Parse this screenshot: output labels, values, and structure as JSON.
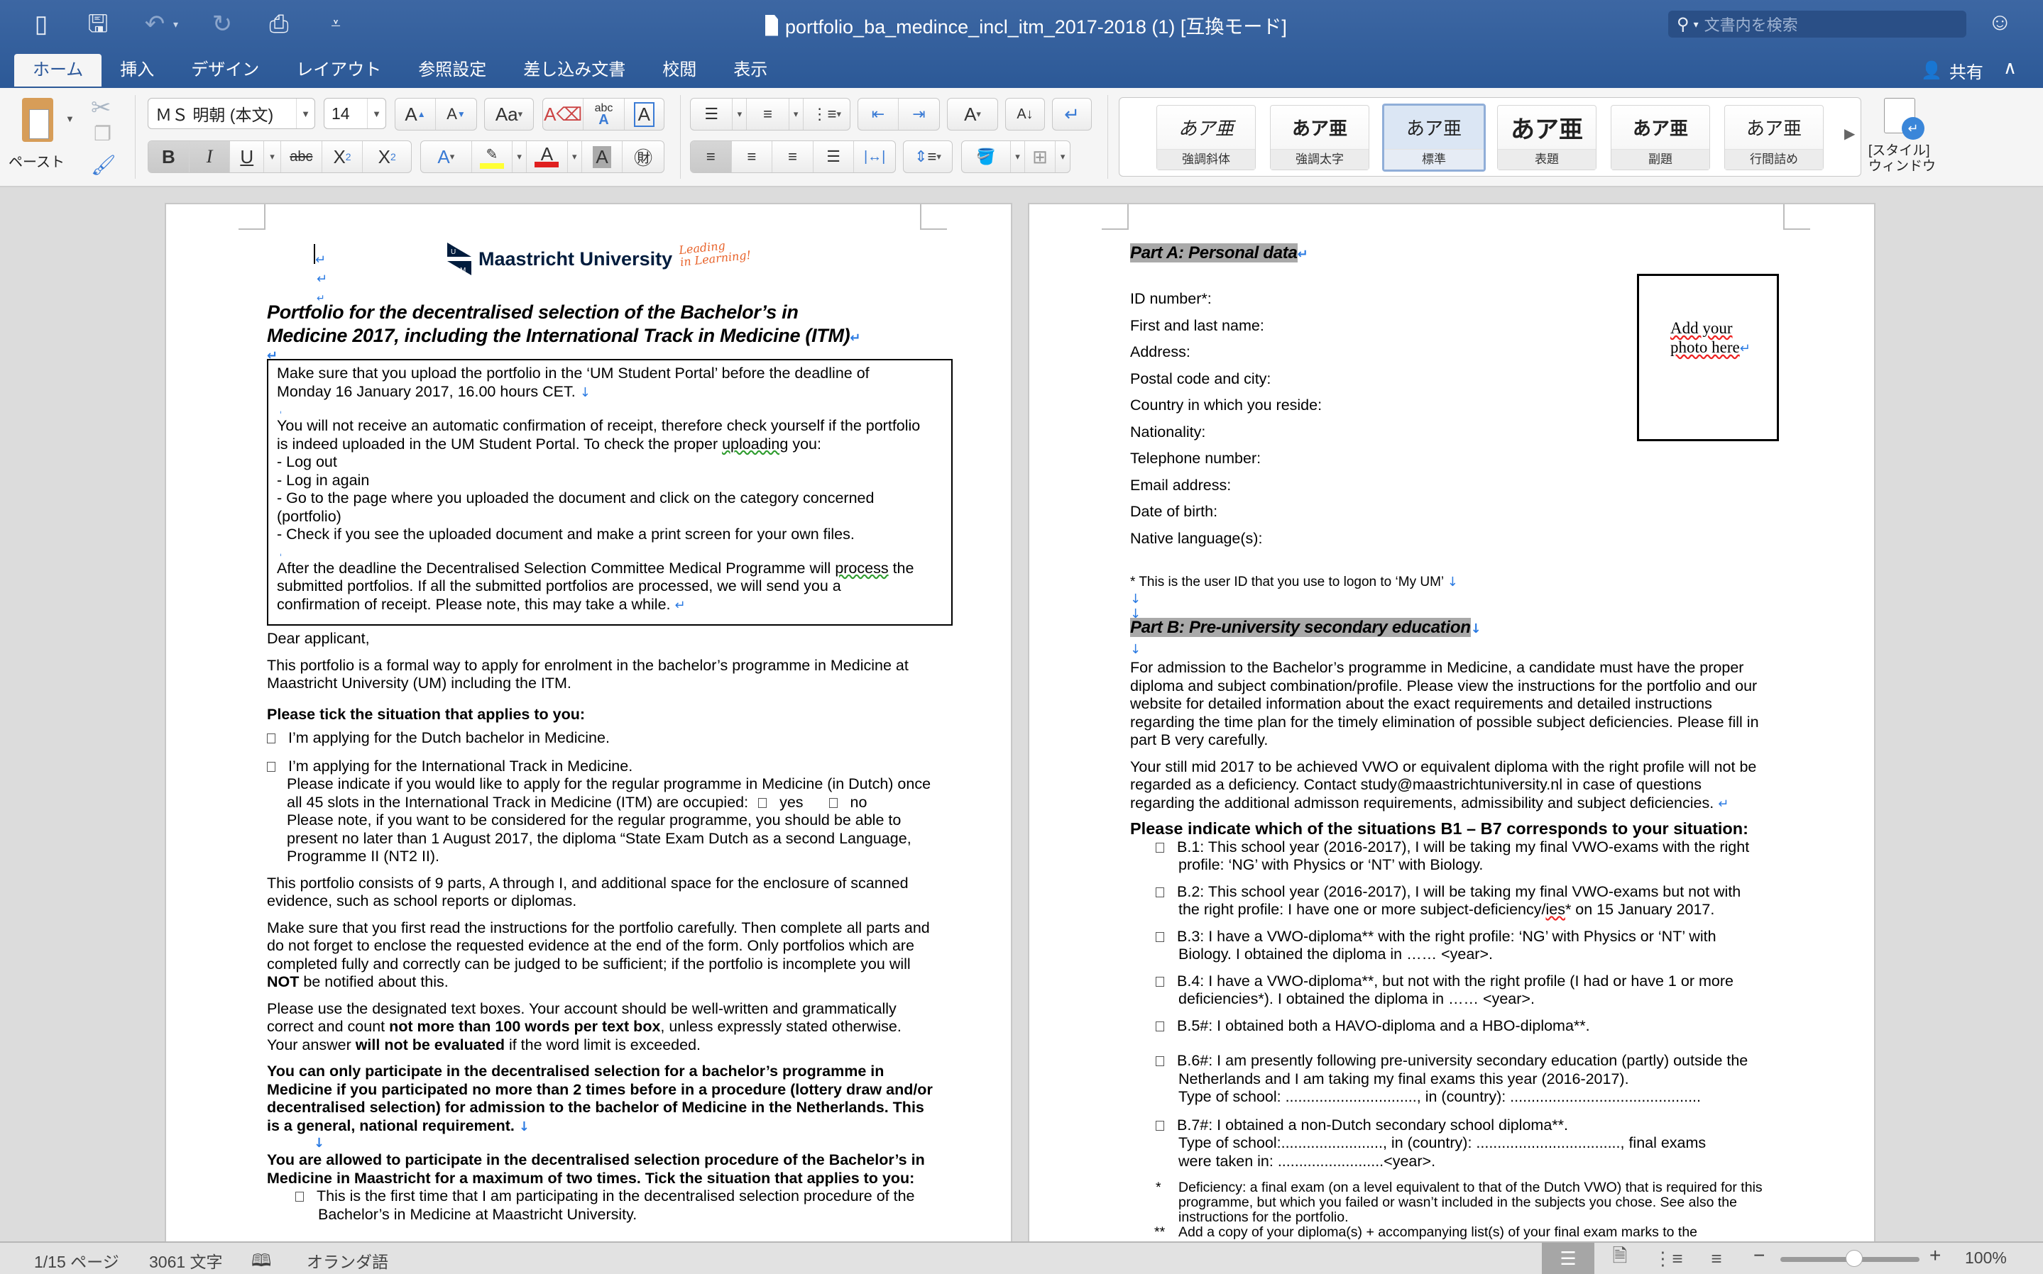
{
  "window": {
    "title": "portfolio_ba_medince_incl_itm_2017-2018 (1) [互換モード]",
    "search_placeholder": "文書内を検索",
    "share_label": "共有"
  },
  "quick_access": [
    {
      "icon": "sidebar-icon"
    },
    {
      "icon": "save-icon"
    },
    {
      "icon": "undo-icon"
    },
    {
      "icon": "redo-icon"
    },
    {
      "icon": "print-icon"
    },
    {
      "icon": "customize-dropdown-icon"
    }
  ],
  "tabs": [
    {
      "label": "ホーム",
      "active": true
    },
    {
      "label": "挿入"
    },
    {
      "label": "デザイン"
    },
    {
      "label": "レイアウト"
    },
    {
      "label": "参照設定"
    },
    {
      "label": "差し込み文書"
    },
    {
      "label": "校閲"
    },
    {
      "label": "表示"
    }
  ],
  "ribbon": {
    "paste_label": "ペースト",
    "font_name": "ＭＳ 明朝 (本文)",
    "font_size": "14",
    "styles": [
      {
        "preview": "あア亜",
        "name": "強調斜体"
      },
      {
        "preview": "あア亜",
        "name": "強調太字"
      },
      {
        "preview": "あア亜",
        "name": "標準",
        "selected": true
      },
      {
        "preview": "あア亜",
        "name": "表題"
      },
      {
        "preview": "あア亜",
        "name": "副題"
      },
      {
        "preview": "あア亜",
        "name": "行間詰め"
      }
    ],
    "style_window_label_1": "[スタイル]",
    "style_window_label_2": "ウィンドウ",
    "colors": {
      "highlight": "#ffff33",
      "font_color": "#e02020"
    }
  },
  "left_page": {
    "logo_name": "Maastricht University",
    "logo_tagline_1": "Leading",
    "logo_tagline_2": "in Learning!",
    "title_line_1": "Portfolio for the decentralised selection of the Bachelor’s in",
    "title_line_2": "Medicine 2017, including the International Track in Medicine (ITM)",
    "box": {
      "p1_line1": "Make sure that you upload the portfolio in the ‘UM Student Portal’ before the deadline of",
      "p1_line2": "Monday 16 January 2017, 16.00 hours CET.",
      "p2_line1": "You will not receive an automatic confirmation of receipt, therefore check yourself if the portfolio",
      "p2_line2a": "is indeed uploaded in the UM Student Portal. To check the proper ",
      "p2_line2b": "uploading",
      "p2_line2c": " you:",
      "steps": [
        "- Log out",
        "- Log in again",
        "- Go to the page where you uploaded the document and click on the category concerned",
        "(portfolio)",
        "- Check if you see the uploaded document and make a print screen for your own files."
      ],
      "p3_line1a": "After the deadline the Decentralised Selection Committee Medical Programme will ",
      "p3_line1b": "process",
      "p3_line1c": "  the",
      "p3_line2": "submitted portfolios. If all the submitted portfolios are processed, we will send you a",
      "p3_line3": "confirmation of receipt. Please note, this may take a while."
    },
    "dear": "Dear applicant,",
    "intro_1": "This portfolio is a formal way to apply for enrolment in the bachelor’s programme in Medicine at",
    "intro_2": "Maastricht University (UM) including the ITM.",
    "tick_heading": "Please tick the situation that applies to you:",
    "opt_dutch": "I’m applying for the Dutch bachelor in Medicine.",
    "opt_itm": "I’m applying for the International Track in Medicine.",
    "itm_q1": " Please indicate if you would like to apply for the regular programme in Medicine (in Dutch) once",
    "itm_q2": "all 45 slots in the International Track in Medicine (ITM) are occupied:",
    "yes": "yes",
    "no": "no",
    "itm_n1": "Please note, if you want to be considered for the regular programme, you should be able to",
    "itm_n2": "present no later than 1 August 2017, the diploma “State Exam Dutch as a second Language,",
    "itm_n3": "Programme II (NT2 II).",
    "parts_1": "This portfolio consists of 9 parts, A through I, and additional space for the enclosure of scanned",
    "parts_2": "evidence, such as school reports or diplomas.",
    "read_1": "Make sure that you first read the instructions for the portfolio carefully. Then complete all parts and",
    "read_2": "do not forget to enclose the requested evidence at the end of the form. Only portfolios which are",
    "read_3": "completed fully and correctly can be judged to be sufficient; if the portfolio is incomplete you will",
    "read_4a": "NOT",
    "read_4b": " be notified about this.",
    "use_1": "Please use the designated text boxes. Your account should be well-written and grammatically",
    "use_2a": "correct and count ",
    "use_2b": "not more than 100 words per text box",
    "use_2c": ", unless expressly stated otherwise.",
    "use_3a": "Your answer ",
    "use_3b": "will not be evaluated",
    "use_3c": " if the word limit is exceeded.",
    "only_1": "You can only participate in the decentralised selection for a bachelor’s programme in",
    "only_2": "Medicine if you participated no more than 2 times before in a procedure (lottery draw and/or",
    "only_3": "decentralised selection) for admission to the bachelor of Medicine in the Netherlands. This",
    "only_4": "is a general, national requirement.",
    "allowed_1": "You are allowed to participate in the decentralised selection procedure of the Bachelor’s in",
    "allowed_2": "Medicine in Maastricht for a maximum of two times. Tick the situation that applies to you:",
    "first_1": "This is the first time that I am participating in the decentralised selection procedure of the",
    "first_2": "Bachelor’s in Medicine at Maastricht University."
  },
  "right_page": {
    "part_a": "Part A: Personal data",
    "fields": [
      "ID number*:",
      "First and last name:",
      "Address:",
      "Postal code and city:",
      "Country in which you reside:",
      "Nationality:",
      "Telephone number:",
      "Email address:",
      "Date of birth:",
      "Native language(s):"
    ],
    "photo_1": "Add your",
    "photo_2": "photo here",
    "id_note": "* This is the user ID that you use to logon to ‘My UM’",
    "part_b": "Part B: Pre-university secondary education",
    "adm_1": "For admission to the Bachelor’s programme in Medicine, a candidate must have the proper",
    "adm_2": "diploma and subject combination/profile. Please view the instructions for the portfolio and our",
    "adm_3": "website for detailed information about the exact requirements and detailed instructions",
    "adm_4": "regarding the time plan for the timely elimination of possible subject deficiencies. Please fill in",
    "adm_5": "part B very carefully.",
    "still_1": "Your still mid 2017 to be achieved VWO or equivalent diploma with the right profile will not be",
    "still_2": "regarded as a deficiency. Contact study@maastrichtuniversity.nl in case of questions",
    "still_3": "regarding the additional admisson requirements, admissibility and subject deficiencies.",
    "indicate": "Please indicate which of the situations B1 – B7 corresponds to your situation:",
    "b1_1": "B.1: This school year (2016-2017), I will be taking my final VWO-exams with the right",
    "b1_2": "profile: ‘NG’ with Physics or ‘NT’ with Biology.",
    "b2_1": "B.2: This school year (2016-2017), I will be taking my final VWO-exams but not with",
    "b2_2a": "the right profile: I have one or more subject-deficiency/",
    "b2_2b": "ies",
    "b2_2c": "* on 15 January 2017.",
    "b3_1": "B.3: I have a VWO-diploma** with the right profile: ‘NG’ with Physics or ‘NT’ with",
    "b3_2": "Biology. I obtained the diploma in …… <year>.",
    "b4_1": "B.4: I have a VWO-diploma**, but not with the right profile (I had or have 1 or more",
    "b4_2": "deficiencies*). I obtained the diploma in …… <year>.",
    "b5": "B.5#: I obtained both a HAVO-diploma and a HBO-diploma**.",
    "b6_1": "B.6#: I am presently following pre-university secondary education (partly) outside the",
    "b6_2": "Netherlands and I am taking my final exams this year (2016-2017).",
    "b6_3": "Type of school: ..............................., in (country):  .............................................",
    "b7_1": "B.7#: I obtained a non-Dutch secondary school diploma**.",
    "b7_2": "Type of school:........................, in (country):  .................................., final exams",
    "b7_3": "were taken in: .........................<year>.",
    "fn1_mark": "*",
    "fn1_1": "Deficiency: a final exam (on a level equivalent to that of the Dutch VWO) that is required for this",
    "fn1_2": "programme, but which you failed or wasn’t included in the subjects you chose. See also the",
    "fn1_3": "instructions for the portfolio.",
    "fn2_mark": "**",
    "fn2_1": "Add a copy of your diploma(s) + accompanying list(s) of your final exam marks to the"
  },
  "status": {
    "page": "1/15 ページ",
    "words": "3061 文字",
    "language": "オランダ語",
    "zoom": "100%",
    "zoom_level_percent": 100
  }
}
